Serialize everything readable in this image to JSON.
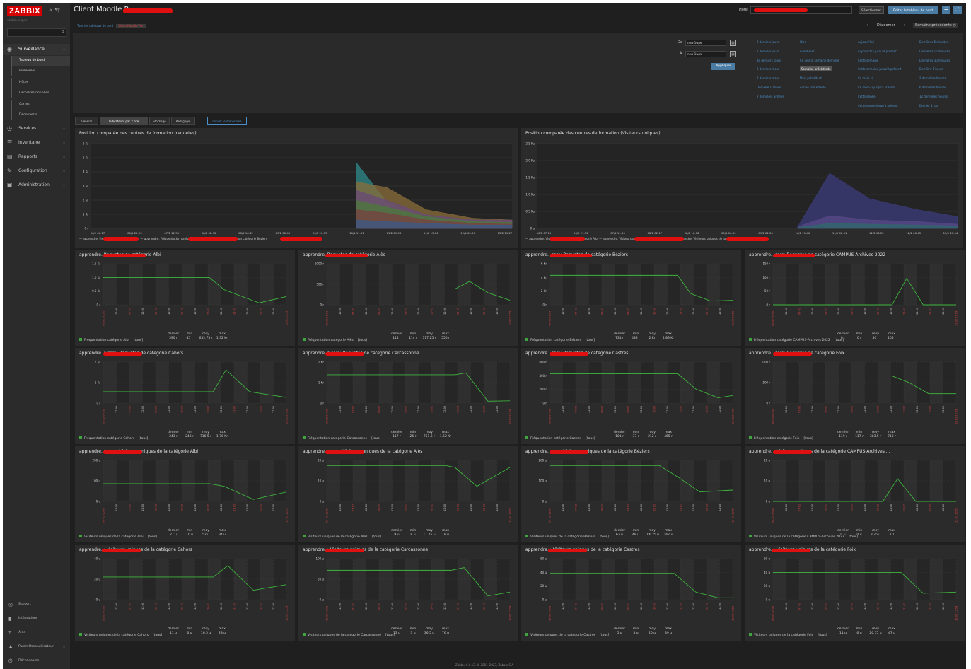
{
  "app": {
    "logo": "ZABBIX",
    "collapse": "« ⇆",
    "subtitle": "zabbix-nurpus"
  },
  "menu": [
    {
      "label": "Surveillance",
      "icon": "eye-icon",
      "glyph": "◉",
      "active": true
    },
    {
      "label": "Services",
      "icon": "clock-icon",
      "glyph": "◷"
    },
    {
      "label": "Inventaire",
      "icon": "list-icon",
      "glyph": "☰"
    },
    {
      "label": "Rapports",
      "icon": "chart-icon",
      "glyph": "▤"
    },
    {
      "label": "Configuration",
      "icon": "wrench-icon",
      "glyph": "✎"
    },
    {
      "label": "Administration",
      "icon": "admin-icon",
      "glyph": "▣"
    }
  ],
  "submenu": [
    "Tableau de bord",
    "Problèmes",
    "Hôtes",
    "Dernières données",
    "Cartes",
    "Découverte"
  ],
  "bottom_menu": [
    {
      "label": "Support",
      "glyph": "◎"
    },
    {
      "label": "Intégrations",
      "glyph": "▮"
    },
    {
      "label": "Aide",
      "glyph": "?"
    },
    {
      "label": "Paramètres utilisateur",
      "glyph": "♟"
    },
    {
      "label": "Déconnexion",
      "glyph": "⏻"
    }
  ],
  "header": {
    "title": "Client Moodle P",
    "host_label": "Hôte",
    "select_label": "Sélectionner",
    "edit_label": "Éditer le tableau de bord"
  },
  "breadcrumb": [
    "Tous les tableaux de bord",
    "Client Moodle Pur"
  ],
  "time_nav": {
    "prev": "‹",
    "zoom": "Dézoomer",
    "next": "›",
    "period": "Semaine précédente"
  },
  "filter": {
    "from_label": "De",
    "from_value": "now-1w/w",
    "to_label": "À",
    "to_value": "now-1w/w",
    "apply": "Appliquer",
    "quick": [
      [
        "2 derniers jours",
        "7 derniers jours",
        "30 derniers jours",
        "3 derniers mois",
        "6 derniers mois",
        "Dernière 1 année",
        "2 dernières années"
      ],
      [
        "Hier",
        "Avant-hier",
        "Ce jour la semaine dernière",
        "Semaine précédente",
        "Mois précédent",
        "Année précédente"
      ],
      [
        "Aujourd'hui",
        "Aujourd'hui jusqu'à présent",
        "Cette semaine",
        "Cette semaine jusqu'à présent",
        "Ce mois-ci",
        "Ce mois-ci jusqu'à présent",
        "Cette année",
        "Cette année jusqu'à présent"
      ],
      [
        "Dernières 5 minutes",
        "Dernières 15 minutes",
        "Dernières 30 minutes",
        "Dernière 1 heure",
        "3 dernières heures",
        "6 dernières heures",
        "12 dernières heures",
        "Dernier 1 jour"
      ]
    ],
    "selected": "Semaine précédente"
  },
  "tabs": [
    "Général",
    "Indicateurs par 2 site",
    "Stockage",
    "Pédagogie",
    "Lancer le diaporama"
  ],
  "big_charts": [
    {
      "title": "Position comparée des centres de formation (requetes)",
      "yticks": [
        "6 Kr",
        "5 Kr",
        "4 Kr",
        "3 Kr",
        "2 Kr",
        "1 Kr",
        "0 r"
      ],
      "xticks": [
        "06/2 06:17",
        "06/2 22:23",
        "07/2 12:30",
        "08/2 02:36",
        "08/2 16:42",
        "09/2 06:49",
        "09/2 20:55",
        "10/2 11:01",
        "11/2 01:08",
        "11/2 15:14",
        "12/2 05:20",
        "12/2 19:27"
      ],
      "legend": "— apprendre. Fréquentation catégorie Albi  — apprendre. Fréquentation catégorie Alès  — apprendre. Fréquentation catégorie Béziers"
    },
    {
      "title": "Position comparée des centres de formation (Visiteurs uniques)",
      "yticks": [
        "2.5 Ku",
        "2.0 Ku",
        "1.5 Ku",
        "1.0 Ku",
        "0.5 Ku",
        "0 u"
      ],
      "xticks": [
        "06/2 07:15",
        "06/2 21:35",
        "07/2 11:55",
        "08/2 02:17",
        "08/2 16:38",
        "09/2 06:59",
        "09/2 21:20",
        "10/2 11:40",
        "11/2 02:01",
        "11/2 16:22",
        "12/2 06:43",
        "12/2 21:04"
      ],
      "legend": "— apprendre. Visiteurs uniques de la catégorie Albi  — apprendre. Visiteurs uniques de la catégorie Alès  — apprendre. Visiteurs uniques de la catégorie Béziers"
    }
  ],
  "graphs": [
    {
      "title": "apprendre.  Requetes de catégorie Albi",
      "y": [
        "1.5 Kr",
        "1.0 Kr",
        "0.5 Kr",
        "0 r"
      ],
      "legend": "Fréquentation catégorie Albi",
      "stats": [
        "390 r",
        "85 r",
        "632.75 r",
        "1.32 Kr"
      ]
    },
    {
      "title": "apprendre.  Requetes de catégorie Alès",
      "y": [
        "1000 r",
        "500 r",
        "0 r"
      ],
      "legend": "Fréquentation catégorie Alès",
      "stats": [
        "114 r",
        "114 r",
        "317.25 r",
        "550 r"
      ]
    },
    {
      "title": "apprendre.  .com: Requetes de catégorie Béziers",
      "y": [
        "6 Kr",
        "4 Kr",
        "2 Kr",
        "0 r"
      ],
      "legend": "Fréquentation catégorie Béziers",
      "stats": [
        "731 r",
        "488 r",
        "2 Kr",
        "4.89 Kr"
      ]
    },
    {
      "title": "apprendre.  .com: Requetes de catégorie CAMPUS-Archives 2022",
      "y": [
        "150 r",
        "100 r",
        "50 r",
        "0 r"
      ],
      "legend": "Fréquentation catégorie CAMPUS-Archives 2022",
      "stats": [
        "0 r",
        "0 r",
        "30 r",
        "105 r"
      ]
    },
    {
      "title": "apprendre.  s.com: Requetes de catégorie Cahors",
      "y": [
        "2 Kr",
        "1 Kr",
        "0 r"
      ],
      "legend": "Fréquentation catégorie Cahors",
      "stats": [
        "243 r",
        "243 r",
        "716.5 r",
        "1.76 Kr"
      ]
    },
    {
      "title": "apprendre.  s.com: Requetes de catégorie Carcassonne",
      "y": [
        "2 Kr",
        "1 Kr",
        "0 r"
      ],
      "legend": "Fréquentation catégorie Carcassonne",
      "stats": [
        "117 r",
        "26 r",
        "751.5 r",
        "1.52 Kr"
      ]
    },
    {
      "title": "apprendre.  .com: Requetes de catégorie Castres",
      "y": [
        "600 r",
        "400 r",
        "200 r",
        "0 r"
      ],
      "legend": "Fréquentation catégorie Castres",
      "stats": [
        "101 r",
        "37 r",
        "212 r",
        "465 r"
      ]
    },
    {
      "title": "apprendre.  .com: Requetes de catégorie Foix",
      "y": [
        "1000 r",
        "500 r",
        "0 r"
      ],
      "legend": "Fréquentation catégorie Foix",
      "stats": [
        "119 r",
        "117 r",
        "383.5 r",
        "713 r"
      ]
    },
    {
      "title": "apprendre.  s.com: Visiteurs uniques de la catégorie Albi",
      "y": [
        "200 u",
        "100 u",
        "0 u"
      ],
      "legend": "Visiteurs uniques de la catégorie Albi",
      "stats": [
        "27 u",
        "10 u",
        "52 u",
        "94 u"
      ]
    },
    {
      "title": "apprendre.  s.com: Visiteurs uniques de la catégorie Alès",
      "y": [
        "20 u",
        "10 u",
        "0 u"
      ],
      "legend": "Visiteurs uniques de la catégorie Alès",
      "stats": [
        "9 u",
        "8 u",
        "11.75 u",
        "18 u"
      ]
    },
    {
      "title": "apprendre.  .com: Visiteurs uniques de la catégorie Béziers",
      "y": [
        "200 u",
        "100 u",
        "0 u"
      ],
      "legend": "Visiteurs uniques de la catégorie Béziers",
      "stats": [
        "63 u",
        "48 u",
        "106.25 u",
        "167 u"
      ]
    },
    {
      "title": "apprendre.  : Visiteurs uniques de la catégorie CAMPUS-Archives ...",
      "y": [
        "20 u",
        "10 u",
        "0 u"
      ],
      "legend": "Visiteurs uniques de la catégorie CAMPUS-Archives 2022",
      "stats": [
        "0 u",
        "0 u",
        "3.25 u",
        "10"
      ]
    },
    {
      "title": "apprendre.  : Visiteurs uniques de la catégorie Cahors",
      "y": [
        "40 u",
        "20 u",
        "0 u"
      ],
      "legend": "Visiteurs uniques de la catégorie Cahors",
      "stats": [
        "11 u",
        "6 u",
        "16.5 u",
        "28 u"
      ]
    },
    {
      "title": "apprendre.  : Visiteurs uniques de la catégorie Carcassonne",
      "y": [
        "100 u",
        "50 u",
        "0 u"
      ],
      "legend": "Visiteurs uniques de la catégorie Carcassonne",
      "stats": [
        "13 u",
        "3 u",
        "36.5 u",
        "76 u"
      ]
    },
    {
      "title": "apprendre.  : Visiteurs uniques de la catégorie Castres",
      "y": [
        "60 u",
        "40 u",
        "20 u",
        "0 u"
      ],
      "legend": "Visiteurs uniques de la catégorie Castres",
      "stats": [
        "5 u",
        "3 u",
        "20 u",
        "39 u"
      ]
    },
    {
      "title": "apprendre.  : Visiteurs uniques de la catégorie Foix",
      "y": [
        "60 u",
        "40 u",
        "20 u",
        "0 u"
      ],
      "legend": "Visiteurs uniques de la catégorie Foix",
      "stats": [
        "11 u",
        "6 u",
        "26.75 u",
        "47 u"
      ]
    }
  ],
  "graph_x": [
    "06-02 00:00",
    "12:00",
    "07-02",
    "12:00",
    "08-02",
    "12:00",
    "09-02",
    "12:00",
    "10-02",
    "12:00",
    "11-02",
    "12:00",
    "12-02",
    "12:00",
    "12-02 23:59"
  ],
  "stat_headers": [
    "dernier",
    "min",
    "moy",
    "max"
  ],
  "legend_suffix": "[tous]",
  "footer": "Zabbix 6.0.13. © 2001–2023, Zabbix SIA"
}
